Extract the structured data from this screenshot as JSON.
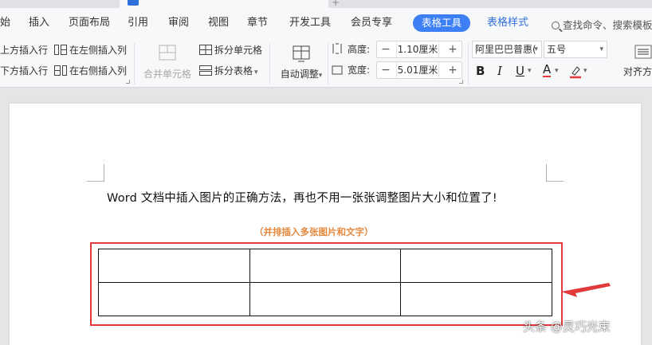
{
  "menu": {
    "items": [
      "始",
      "插入",
      "页面布局",
      "引用",
      "审阅",
      "视图",
      "章节",
      "开发工具",
      "会员专享"
    ],
    "table_tools": "表格工具",
    "table_style": "表格样式",
    "search": "查找命令、搜索模板"
  },
  "ribbon": {
    "insert_above": "上方插入行",
    "insert_below": "下方插入行",
    "insert_left": "在左侧插入列",
    "insert_right": "在右侧插入列",
    "merge_cells": "合并单元格",
    "split_cells": "拆分单元格",
    "split_table": "拆分表格",
    "auto_fit": "自动调整",
    "height_label": "高度:",
    "height_value": "1.10厘米",
    "width_label": "宽度:",
    "width_value": "5.01厘米",
    "font_name": "阿里巴巴普惠(",
    "font_size": "五号",
    "align": "对齐方"
  },
  "document": {
    "title": "Word 文档中插入图片的正确方法，再也不用一张张调整图片大小和位置了!",
    "subtitle": "（并排插入多张图片和文字）",
    "table": {
      "rows": 2,
      "cols": 3
    }
  },
  "watermark": "头条 @灵巧光束",
  "colors": {
    "accent": "#3d7ff5",
    "highlight": "#e03a3a",
    "subtitle": "#e6883d"
  }
}
